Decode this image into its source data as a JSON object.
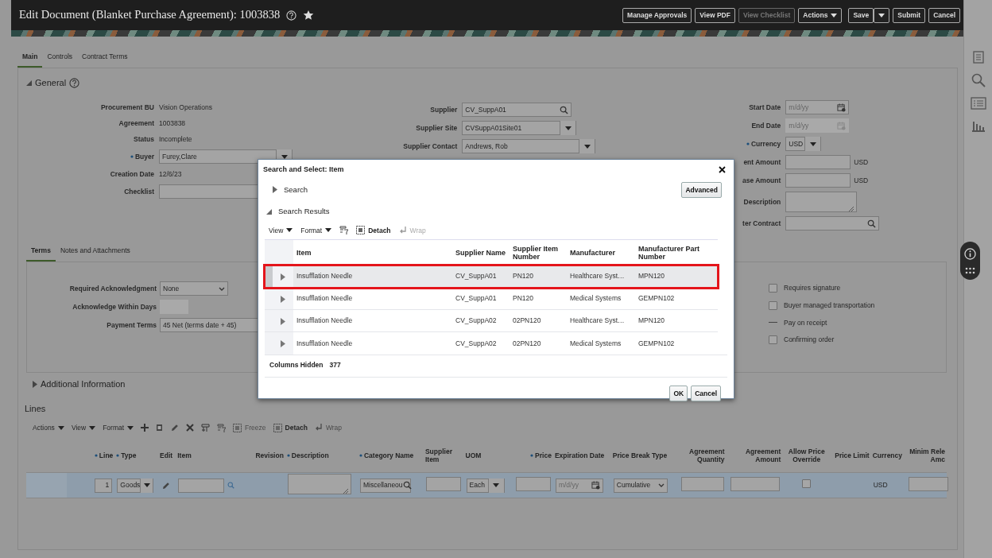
{
  "header": {
    "title": "Edit Document (Blanket Purchase Agreement): 1003838",
    "buttons": [
      {
        "label": "Manage Approvals",
        "kind": "button",
        "disabled": false
      },
      {
        "label": "View PDF",
        "kind": "button",
        "disabled": false
      },
      {
        "label": "View Checklist",
        "kind": "button",
        "disabled": true
      },
      {
        "label": "Actions",
        "kind": "menu",
        "disabled": false
      },
      {
        "label": "Save",
        "kind": "split",
        "disabled": false
      },
      {
        "label": "Submit",
        "kind": "button",
        "disabled": false
      },
      {
        "label": "Cancel",
        "kind": "button",
        "disabled": false
      }
    ]
  },
  "tabs": [
    {
      "label": "Main",
      "selected": true
    },
    {
      "label": "Controls",
      "selected": false
    },
    {
      "label": "Contract Terms",
      "selected": false
    }
  ],
  "general": {
    "title": "General",
    "expanded": true,
    "col_1": [
      {
        "label": "Procurement BU",
        "value": "Vision Operations",
        "kind": "text",
        "required": false
      },
      {
        "label": "Agreement",
        "value": "1003838",
        "kind": "text",
        "required": false
      },
      {
        "label": "Status",
        "value": "Incomplete",
        "kind": "text",
        "required": false
      },
      {
        "label": "Buyer",
        "value": "Furey,Clare",
        "kind": "select",
        "required": true
      },
      {
        "label": "Creation Date",
        "value": "12/6/23",
        "kind": "text",
        "required": false
      },
      {
        "label": "Checklist",
        "kind": "input",
        "required": false
      }
    ],
    "col_2": [
      {
        "label": "Supplier",
        "value": "CV_SuppA01",
        "kind": "search",
        "required": false
      },
      {
        "label": "Supplier Site",
        "value": "CVSuppA01Site01",
        "kind": "select",
        "required": false
      },
      {
        "label": "Supplier Contact",
        "value": "Andrews, Rob",
        "kind": "select",
        "required": false
      }
    ],
    "col_3": [
      {
        "label": "Start Date",
        "placeholder": "m/d/yy",
        "kind": "date",
        "required": false,
        "disabled": false
      },
      {
        "label": "End Date",
        "placeholder": "m/d/yy",
        "kind": "date",
        "required": false,
        "disabled": true
      },
      {
        "label": "Currency",
        "value": "USD",
        "kind": "select",
        "required": true
      },
      {
        "label": "ent Amount",
        "kind": "amount",
        "suffix": "USD",
        "required": false
      },
      {
        "label": "ase Amount",
        "kind": "amount",
        "suffix": "USD",
        "required": false
      },
      {
        "label": "Description",
        "kind": "textarea",
        "required": false
      },
      {
        "label": "ter Contract",
        "kind": "search",
        "required": false
      }
    ]
  },
  "terms": {
    "tabs": [
      {
        "label": "Terms",
        "selected": true
      },
      {
        "label": "Notes and Attachments",
        "selected": false
      }
    ],
    "fields": [
      {
        "label": "Required Acknowledgment",
        "value": "None",
        "kind": "chevron",
        "disabled": false
      },
      {
        "label": "Acknowledge Within Days",
        "kind": "input",
        "disabled": true
      },
      {
        "label": "Payment Terms",
        "value": "45 Net (terms date + 45)",
        "kind": "input",
        "disabled": false
      }
    ],
    "options": [
      {
        "label": "Requires signature",
        "kind": "checkbox",
        "checked": false
      },
      {
        "label": "Buyer managed transportation",
        "kind": "checkbox",
        "checked": false
      },
      {
        "label": "Pay on receipt",
        "kind": "readonly",
        "checked": false
      },
      {
        "label": "Confirming order",
        "kind": "checkbox",
        "checked": false
      }
    ]
  },
  "additional": {
    "title": "Additional Information",
    "expanded": false
  },
  "lines": {
    "title": "Lines",
    "menus": [
      "Actions",
      "View",
      "Format"
    ],
    "tools": [
      {
        "label": "Freeze",
        "disabled": true
      },
      {
        "label": "Detach",
        "disabled": false
      },
      {
        "label": "Wrap",
        "disabled": true
      }
    ],
    "columns": [
      {
        "label": "Line",
        "required": true
      },
      {
        "label": "Type",
        "required": true
      },
      {
        "label": "Edit",
        "required": false
      },
      {
        "label": "Item",
        "required": false
      },
      {
        "label": "Revision",
        "required": false
      },
      {
        "label": "Description",
        "required": true
      },
      {
        "label": "Category Name",
        "required": true
      },
      {
        "label": "Supplier Item",
        "required": false
      },
      {
        "label": "UOM",
        "required": false
      },
      {
        "label": "Price",
        "required": true
      },
      {
        "label": "Expiration Date",
        "required": false
      },
      {
        "label": "Price Break Type",
        "required": false
      },
      {
        "label": "Agreement Quantity",
        "required": false
      },
      {
        "label": "Agreement Amount",
        "required": false
      },
      {
        "label": "Allow Price Override",
        "required": false
      },
      {
        "label": "Price Limit",
        "required": false
      },
      {
        "label": "Currency",
        "required": false
      },
      {
        "label": "Minim Rele Amc",
        "required": false
      }
    ],
    "rows": [
      {
        "selected": true,
        "cells": [
          {
            "kind": "input",
            "value": "1"
          },
          {
            "kind": "select",
            "value": "Goods"
          },
          {
            "kind": "edit"
          },
          {
            "kind": "search"
          },
          {
            "kind": "empty"
          },
          {
            "kind": "textarea"
          },
          {
            "kind": "search",
            "value": "Miscellaneou"
          },
          {
            "kind": "input"
          },
          {
            "kind": "select",
            "value": "Each"
          },
          {
            "kind": "input"
          },
          {
            "kind": "date",
            "placeholder": "m/d/yy"
          },
          {
            "kind": "chevron",
            "value": "Cumulative"
          },
          {
            "kind": "input"
          },
          {
            "kind": "input"
          },
          {
            "kind": "checkbox",
            "checked": false
          },
          {
            "kind": "empty"
          },
          {
            "kind": "text",
            "value": "USD"
          },
          {
            "kind": "input"
          }
        ]
      }
    ]
  },
  "dialog": {
    "title": "Search and Select: Item",
    "search": {
      "label": "Search",
      "expanded": false
    },
    "advanced": "Advanced",
    "results": {
      "label": "Search Results",
      "expanded": true
    },
    "menus": [
      "View",
      "Format"
    ],
    "tools": [
      {
        "label": "Detach",
        "disabled": false
      },
      {
        "label": "Wrap",
        "disabled": true
      }
    ],
    "columns": [
      "Item",
      "Supplier Name",
      "Supplier Item Number",
      "Manufacturer",
      "Manufacturer Part Number"
    ],
    "rows": [
      {
        "selected": true,
        "highlighted": true,
        "cells": [
          "Insufflation Needle",
          "CV_SuppA01",
          "PN120",
          "Healthcare Syst…",
          "MPN120"
        ]
      },
      {
        "selected": false,
        "highlighted": false,
        "cells": [
          "Insufflation Needle",
          "CV_SuppA01",
          "PN120",
          "Medical Systems",
          "GEMPN102"
        ]
      },
      {
        "selected": false,
        "highlighted": false,
        "cells": [
          "Insufflation Needle",
          "CV_SuppA02",
          "02PN120",
          "Healthcare Syst…",
          "MPN120"
        ]
      },
      {
        "selected": false,
        "highlighted": false,
        "cells": [
          "Insufflation Needle",
          "CV_SuppA02",
          "02PN120",
          "Medical Systems",
          "GEMPN102"
        ]
      }
    ],
    "hidden_label": "Columns Hidden",
    "hidden_count": "377",
    "buttons": [
      "OK",
      "Cancel"
    ]
  }
}
